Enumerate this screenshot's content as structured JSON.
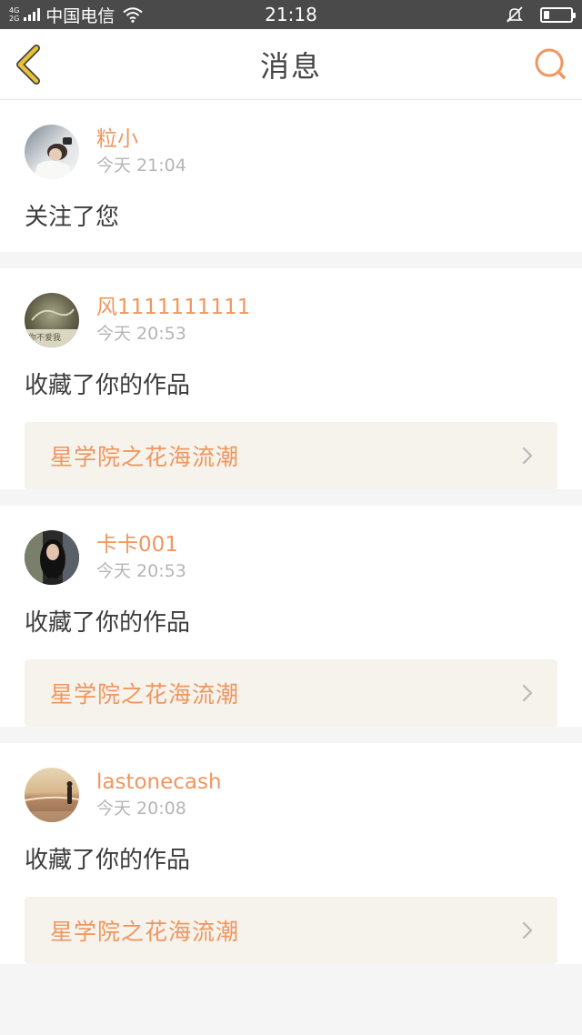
{
  "status_bar": {
    "network_types": [
      "4G",
      "2G"
    ],
    "carrier": "中国电信",
    "time": "21:18",
    "icons": [
      "signal-icon",
      "wifi-icon",
      "mute-icon",
      "battery-icon"
    ],
    "battery_level": 0.2
  },
  "navbar": {
    "title": "消息",
    "back_icon": "chevron-left-icon",
    "search_icon": "search-icon",
    "back_color": "#e8c233",
    "search_color": "#f0965f"
  },
  "colors": {
    "accent": "#f0965f",
    "text": "#3c3c3c",
    "muted": "#b5b5b5",
    "link_bg": "#f5f3ec"
  },
  "messages": [
    {
      "username": "粒小",
      "time": "今天 21:04",
      "action": "关注了您",
      "avatar": "avatar-portrait"
    },
    {
      "username": "风1111111111",
      "time": "今天 20:53",
      "action": "收藏了你的作品",
      "work": "星学院之花海流潮",
      "avatar": "avatar-text-image",
      "avatar_caption": "你不爱我"
    },
    {
      "username": "卡卡001",
      "time": "今天 20:53",
      "action": "收藏了你的作品",
      "work": "星学院之花海流潮",
      "avatar": "avatar-portrait"
    },
    {
      "username": "lastonecash",
      "time": "今天 20:08",
      "action": "收藏了你的作品",
      "work": "星学院之花海流潮",
      "avatar": "avatar-beach"
    }
  ]
}
